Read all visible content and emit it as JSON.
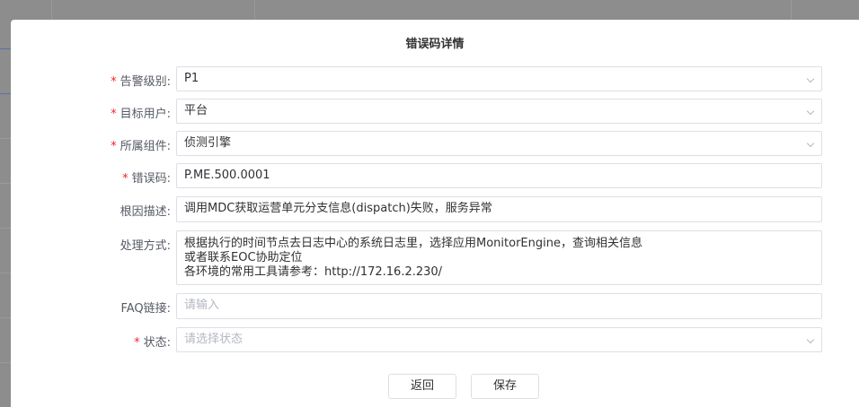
{
  "dialog": {
    "title": "错误码详情"
  },
  "form": {
    "alert_level": {
      "label": "告警级别:",
      "required": true,
      "value": "P1"
    },
    "target_user": {
      "label": "目标用户:",
      "required": true,
      "value": "平台"
    },
    "component": {
      "label": "所属组件:",
      "required": true,
      "value": "侦测引擎"
    },
    "error_code": {
      "label": "错误码:",
      "required": true,
      "value": "P.ME.500.0001"
    },
    "root_cause": {
      "label": "根因描述:",
      "required": false,
      "value": "调用MDC获取运营单元分支信息(dispatch)失败，服务异常"
    },
    "handling": {
      "label": "处理方式:",
      "required": false,
      "lines": [
        "根据执行的时间节点去日志中心的系统日志里，选择应用MonitorEngine，查询相关信息",
        "或者联系EOC协助定位",
        "各环境的常用工具请参考：http://172.16.2.230/"
      ]
    },
    "faq_link": {
      "label": "FAQ链接:",
      "required": false,
      "placeholder": "请输入"
    },
    "status": {
      "label": "状态:",
      "required": true,
      "placeholder": "请选择状态"
    }
  },
  "buttons": {
    "back": "返回",
    "save": "保存"
  },
  "colors": {
    "required_mark": "#f5222d",
    "border": "#dcdfe6",
    "placeholder": "#b4b8c0"
  }
}
